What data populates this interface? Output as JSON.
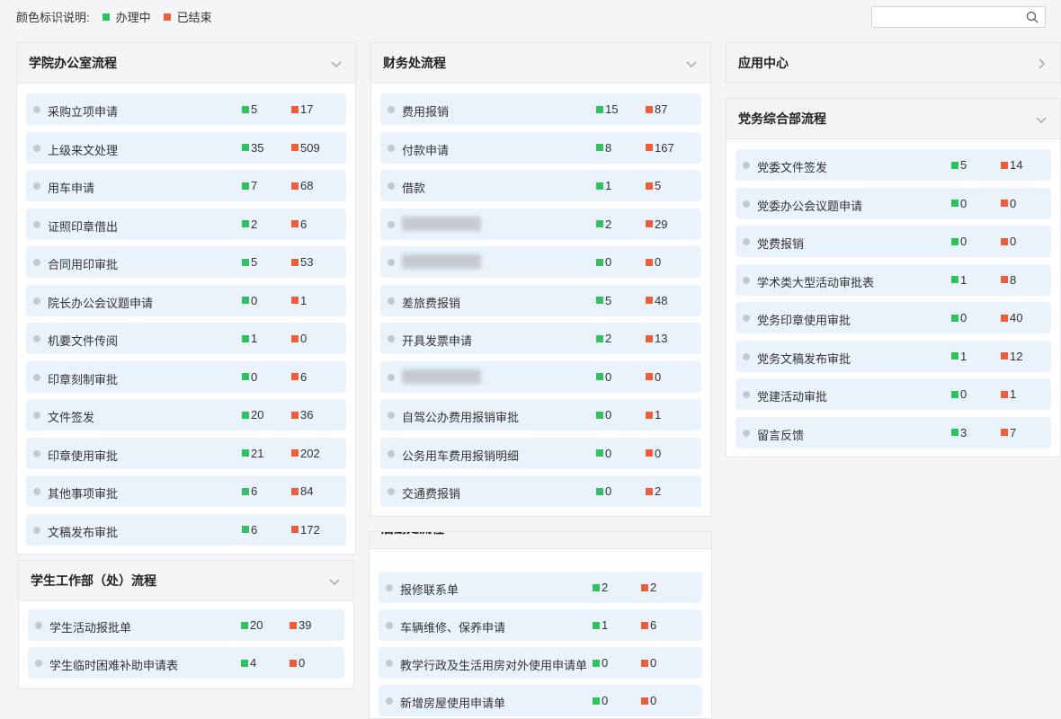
{
  "legend": {
    "label": "颜色标识说明:",
    "active": "办理中",
    "done": "已结束",
    "active_color": "#2fc35f",
    "done_color": "#ec5f3a"
  },
  "search": {
    "placeholder": ""
  },
  "panels": [
    {
      "id": "college",
      "title": "学院办公室流程",
      "chevron": "chevron-down-icon",
      "rows": [
        {
          "label": "采购立项申请",
          "active": "5",
          "done": "17"
        },
        {
          "label": "上级来文处理",
          "active": "35",
          "done": "509"
        },
        {
          "label": "用车申请",
          "active": "7",
          "done": "68"
        },
        {
          "label": "证照印章借出",
          "active": "2",
          "done": "6"
        },
        {
          "label": "合同用印审批",
          "active": "5",
          "done": "53"
        },
        {
          "label": "院长办公会议题申请",
          "active": "0",
          "done": "1"
        },
        {
          "label": "机要文件传阅",
          "active": "1",
          "done": "0"
        },
        {
          "label": "印章刻制审批",
          "active": "0",
          "done": "6"
        },
        {
          "label": "文件签发",
          "active": "20",
          "done": "36"
        },
        {
          "label": "印章使用审批",
          "active": "21",
          "done": "202"
        },
        {
          "label": "其他事项审批",
          "active": "6",
          "done": "84"
        },
        {
          "label": "文稿发布审批",
          "active": "6",
          "done": "172"
        }
      ]
    },
    {
      "id": "finance",
      "title": "财务处流程",
      "chevron": "chevron-down-icon",
      "rows": [
        {
          "label": "费用报销",
          "active": "15",
          "done": "87"
        },
        {
          "label": "付款申请",
          "active": "8",
          "done": "167"
        },
        {
          "label": "借款",
          "active": "1",
          "done": "5"
        },
        {
          "label": "",
          "active": "2",
          "done": "29",
          "blurred": true
        },
        {
          "label": "",
          "active": "0",
          "done": "0",
          "blurred": true
        },
        {
          "label": "差旅费报销",
          "active": "5",
          "done": "48"
        },
        {
          "label": "开具发票申请",
          "active": "2",
          "done": "13"
        },
        {
          "label": "",
          "active": "0",
          "done": "0",
          "blurred": true
        },
        {
          "label": "自驾公办费用报销审批",
          "active": "0",
          "done": "1"
        },
        {
          "label": "公务用车费用报销明细",
          "active": "0",
          "done": "0"
        },
        {
          "label": "交通费报销",
          "active": "0",
          "done": "2"
        }
      ]
    },
    {
      "id": "apps",
      "title": "应用中心",
      "chevron": "chevron-right-icon",
      "rows": []
    },
    {
      "id": "party",
      "title": "党务综合部流程",
      "chevron": "chevron-down-icon",
      "rows": [
        {
          "label": "党委文件签发",
          "active": "5",
          "done": "14"
        },
        {
          "label": "党委办公会议题申请",
          "active": "0",
          "done": "0"
        },
        {
          "label": "党费报销",
          "active": "0",
          "done": "0"
        },
        {
          "label": "学术类大型活动审批表",
          "active": "1",
          "done": "8"
        },
        {
          "label": "党务印章使用审批",
          "active": "0",
          "done": "40"
        },
        {
          "label": "党务文稿发布审批",
          "active": "1",
          "done": "12"
        },
        {
          "label": "党建活动审批",
          "active": "0",
          "done": "1"
        },
        {
          "label": "留言反馈",
          "active": "3",
          "done": "7"
        }
      ]
    },
    {
      "id": "student",
      "title": "学生工作部（处）流程",
      "chevron": "chevron-down-icon",
      "rows": [
        {
          "label": "学生活动报批单",
          "active": "20",
          "done": "39"
        },
        {
          "label": "学生临时困难补助申请表",
          "active": "4",
          "done": "0"
        }
      ]
    },
    {
      "id": "logistics",
      "title": "后勤处流程",
      "chevron": "",
      "rows": [
        {
          "label": "报修联系单",
          "active": "2",
          "done": "2"
        },
        {
          "label": "车辆维修、保养申请",
          "active": "1",
          "done": "6"
        },
        {
          "label": "教学行政及生活用房对外使用申请单",
          "active": "0",
          "done": "0"
        },
        {
          "label": "新增房屋使用申请单",
          "active": "0",
          "done": "0"
        }
      ]
    }
  ]
}
